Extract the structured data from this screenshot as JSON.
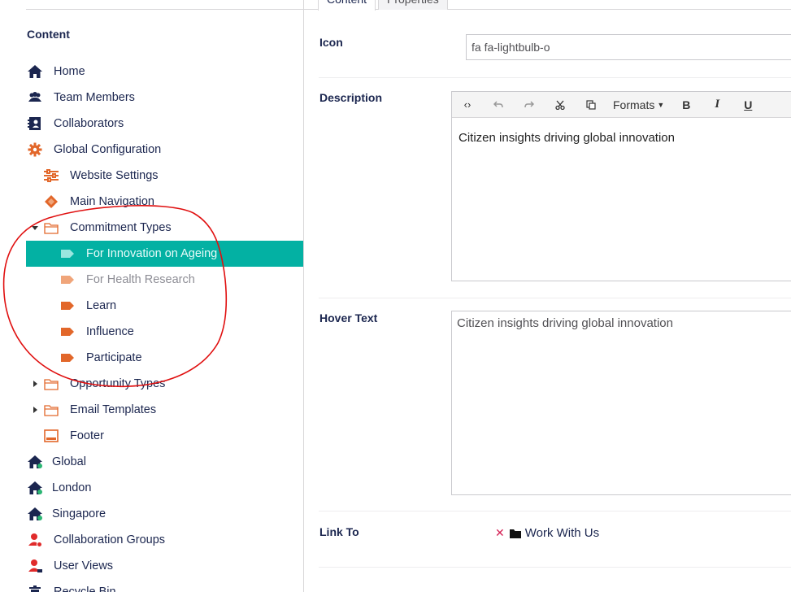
{
  "tabs": [
    {
      "label": "Content"
    },
    {
      "label": "Properties"
    }
  ],
  "tree": {
    "heading": "Content",
    "items": [
      {
        "label": "Home",
        "icon": "home-icon"
      },
      {
        "label": "Team Members",
        "icon": "users-icon"
      },
      {
        "label": "Collaborators",
        "icon": "contact-book-icon"
      },
      {
        "label": "Global Configuration",
        "icon": "gear-icon"
      },
      {
        "label": "Website Settings",
        "icon": "sliders-icon"
      },
      {
        "label": "Main Navigation",
        "icon": "diamond-icon"
      },
      {
        "label": "Commitment Types",
        "icon": "folder-icon"
      },
      {
        "label": "For Innovation on Ageing",
        "icon": "tag-icon"
      },
      {
        "label": "For Health Research",
        "icon": "tag-icon"
      },
      {
        "label": "Learn",
        "icon": "tag-icon"
      },
      {
        "label": "Influence",
        "icon": "tag-icon"
      },
      {
        "label": "Participate",
        "icon": "tag-icon"
      },
      {
        "label": "Opportunity Types",
        "icon": "folder-icon"
      },
      {
        "label": "Email Templates",
        "icon": "folder-icon"
      },
      {
        "label": "Footer",
        "icon": "footer-icon"
      },
      {
        "label": "Global",
        "icon": "home-globe-icon"
      },
      {
        "label": "London",
        "icon": "home-globe-icon"
      },
      {
        "label": "Singapore",
        "icon": "home-globe-icon"
      },
      {
        "label": "Collaboration Groups",
        "icon": "user-group-icon"
      },
      {
        "label": "User Views",
        "icon": "user-icon"
      },
      {
        "label": "Recycle Bin",
        "icon": "trash-icon"
      }
    ]
  },
  "editor": {
    "icon_label": "Icon",
    "icon_value": "fa fa-lightbulb-o",
    "description_label": "Description",
    "toolbar": {
      "formats_label": "Formats",
      "bold_label": "B",
      "italic_label": "I",
      "underline_label": "U"
    },
    "description_value": "Citizen insights driving global innovation",
    "hover_label": "Hover Text",
    "hover_value": "Citizen insights driving global innovation",
    "link_label": "Link To",
    "link_value": "Work With Us"
  },
  "colors": {
    "accent_teal": "#03b1a3",
    "icon_orange": "#e2672a",
    "icon_orange_light": "#f0a57a",
    "navy": "#1b264f",
    "annotation_red": "#e01010",
    "remove_red": "#d42054"
  }
}
